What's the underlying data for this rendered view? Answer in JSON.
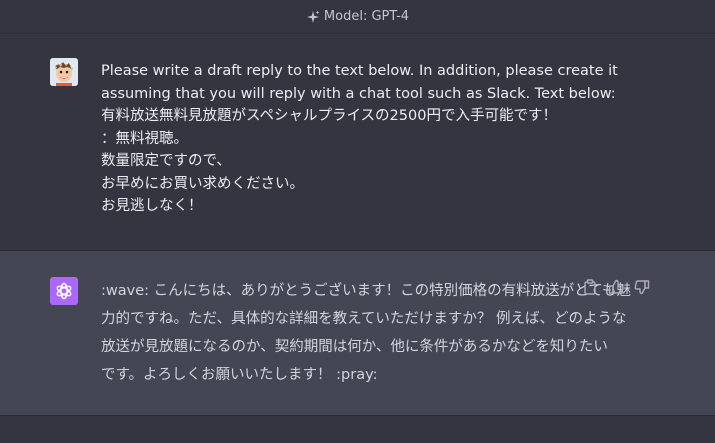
{
  "header": {
    "model_label": "Model: GPT-4"
  },
  "user_message": {
    "lines": [
      "Please write a draft reply to the text below. In addition, please create it",
      "assuming that you will reply with a chat tool such as Slack. Text below:",
      "有料放送無料見放題がスペシャルプライスの2500円で入手可能です！",
      "：無料視聴。",
      "数量限定ですので、",
      "お早めにお買い求めください。",
      "お見逃しなく！"
    ]
  },
  "assistant_message": {
    "lines": [
      ":wave: こんにちは、ありがとうございます！この特別価格の有料放送がとても魅",
      "力的ですね。ただ、具体的な詳細を教えていただけますか？ 例えば、どのような",
      "放送が見放題になるのか、契約期間は何か、他に条件があるかなどを知りたい",
      "です。よろしくお願いいたします！ :pray:"
    ]
  },
  "icons": {
    "model": "sparkle-icon",
    "user_avatar": "user-avatar-icon",
    "assistant_avatar": "openai-logo-icon",
    "copy": "copy-icon",
    "thumbs_up": "thumbs-up-icon",
    "thumbs_down": "thumbs-down-icon"
  },
  "colors": {
    "background": "#343541",
    "assistant_background": "#444654",
    "assistant_avatar": "#ab68ff",
    "text": "#ececf1"
  }
}
